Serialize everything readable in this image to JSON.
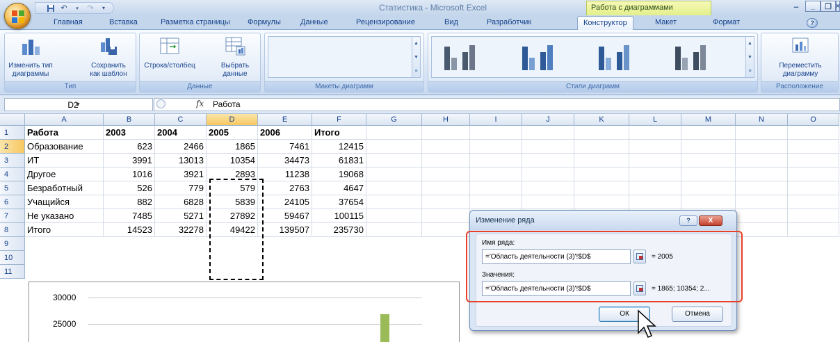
{
  "window": {
    "title": "Статистика - Microsoft Excel",
    "context_title": "Работа с диаграммами"
  },
  "tabs": [
    "Главная",
    "Вставка",
    "Разметка страницы",
    "Формулы",
    "Данные",
    "Рецензирование",
    "Вид",
    "Разработчик",
    "Конструктор",
    "Макет",
    "Формат"
  ],
  "active_tab": "Конструктор",
  "ribbon": {
    "type_group": {
      "label": "Тип",
      "change_type": [
        "Изменить тип",
        "диаграммы"
      ],
      "save_template": [
        "Сохранить",
        "как шаблон"
      ]
    },
    "data_group": {
      "label": "Данные",
      "row_col": "Строка/столбец",
      "select_data": [
        "Выбрать",
        "данные"
      ]
    },
    "layouts_group": {
      "label": "Макеты диаграмм"
    },
    "styles_group": {
      "label": "Стили диаграмм"
    },
    "location_group": {
      "label": "Расположение",
      "move_chart": [
        "Переместить",
        "диаграмму"
      ]
    }
  },
  "formula_bar": {
    "name_box": "D2",
    "fx": "fx",
    "value": "Работа"
  },
  "columns": [
    "A",
    "B",
    "C",
    "D",
    "E",
    "F",
    "G",
    "H",
    "I",
    "J",
    "K",
    "L",
    "M",
    "N",
    "O"
  ],
  "rows": [
    "1",
    "2",
    "3",
    "4",
    "5",
    "6",
    "7",
    "8",
    "9",
    "10",
    "11"
  ],
  "table": [
    [
      "Работа",
      "2003",
      "2004",
      "2005",
      "2006",
      "Итого"
    ],
    [
      "Образование",
      "623",
      "2466",
      "1865",
      "7461",
      "12415"
    ],
    [
      "ИТ",
      "3991",
      "13013",
      "10354",
      "34473",
      "61831"
    ],
    [
      "Другое",
      "1016",
      "3921",
      "2893",
      "11238",
      "19068"
    ],
    [
      "Безработный",
      "526",
      "779",
      "579",
      "2763",
      "4647"
    ],
    [
      "Учащийся",
      "882",
      "6828",
      "5839",
      "24105",
      "37654"
    ],
    [
      "Не указано",
      "7485",
      "5271",
      "27892",
      "59467",
      "100115"
    ],
    [
      "Итого",
      "14523",
      "32278",
      "49422",
      "139507",
      "235730"
    ]
  ],
  "chart": {
    "ticks": [
      "30000",
      "25000"
    ],
    "bar_color": "#9bbb59"
  },
  "dialog": {
    "title": "Изменение ряда",
    "help": "?",
    "close": "X",
    "name_label": "Имя ряда:",
    "name_value": "='Область деятельности (3)'!$D$",
    "name_result": "= 2005",
    "values_label": "Значения:",
    "values_value": "='Область деятельности (3)'!$D$",
    "values_result": "= 1865; 10354; 2...",
    "ok": "ОК",
    "cancel": "Отмена"
  },
  "colors": {
    "highlight": "#e8412a",
    "ribbon_text": "#15428b",
    "context_tab": "#e3ef8a"
  }
}
